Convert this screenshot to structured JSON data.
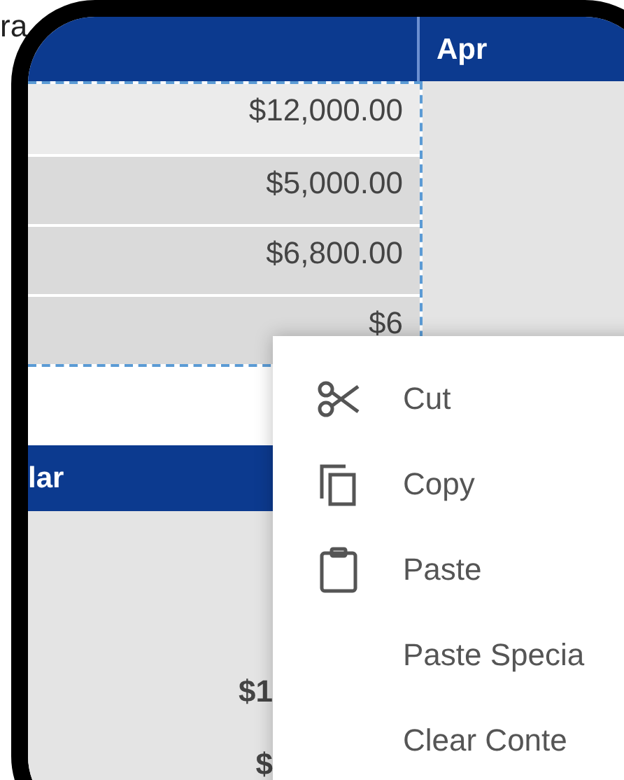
{
  "outside_label": "ra",
  "top_table": {
    "columns": [
      "",
      "Apr"
    ],
    "rows": [
      {
        "amount": "$12,000.00"
      },
      {
        "amount": "$5,000.00"
      },
      {
        "amount": "$6,800.00"
      },
      {
        "amount": "$6"
      }
    ],
    "selection_dashed": true
  },
  "bottom_table": {
    "header": "lar",
    "cells": [
      "",
      "",
      "$1",
      "$"
    ]
  },
  "context_menu": [
    {
      "label": "Cut",
      "kind": "cut"
    },
    {
      "label": "Copy",
      "kind": "copy"
    },
    {
      "label": "Paste",
      "kind": "paste"
    },
    {
      "label": "Paste Specia",
      "kind": "plain"
    },
    {
      "label": "Clear Conte",
      "kind": "plain"
    }
  ]
}
